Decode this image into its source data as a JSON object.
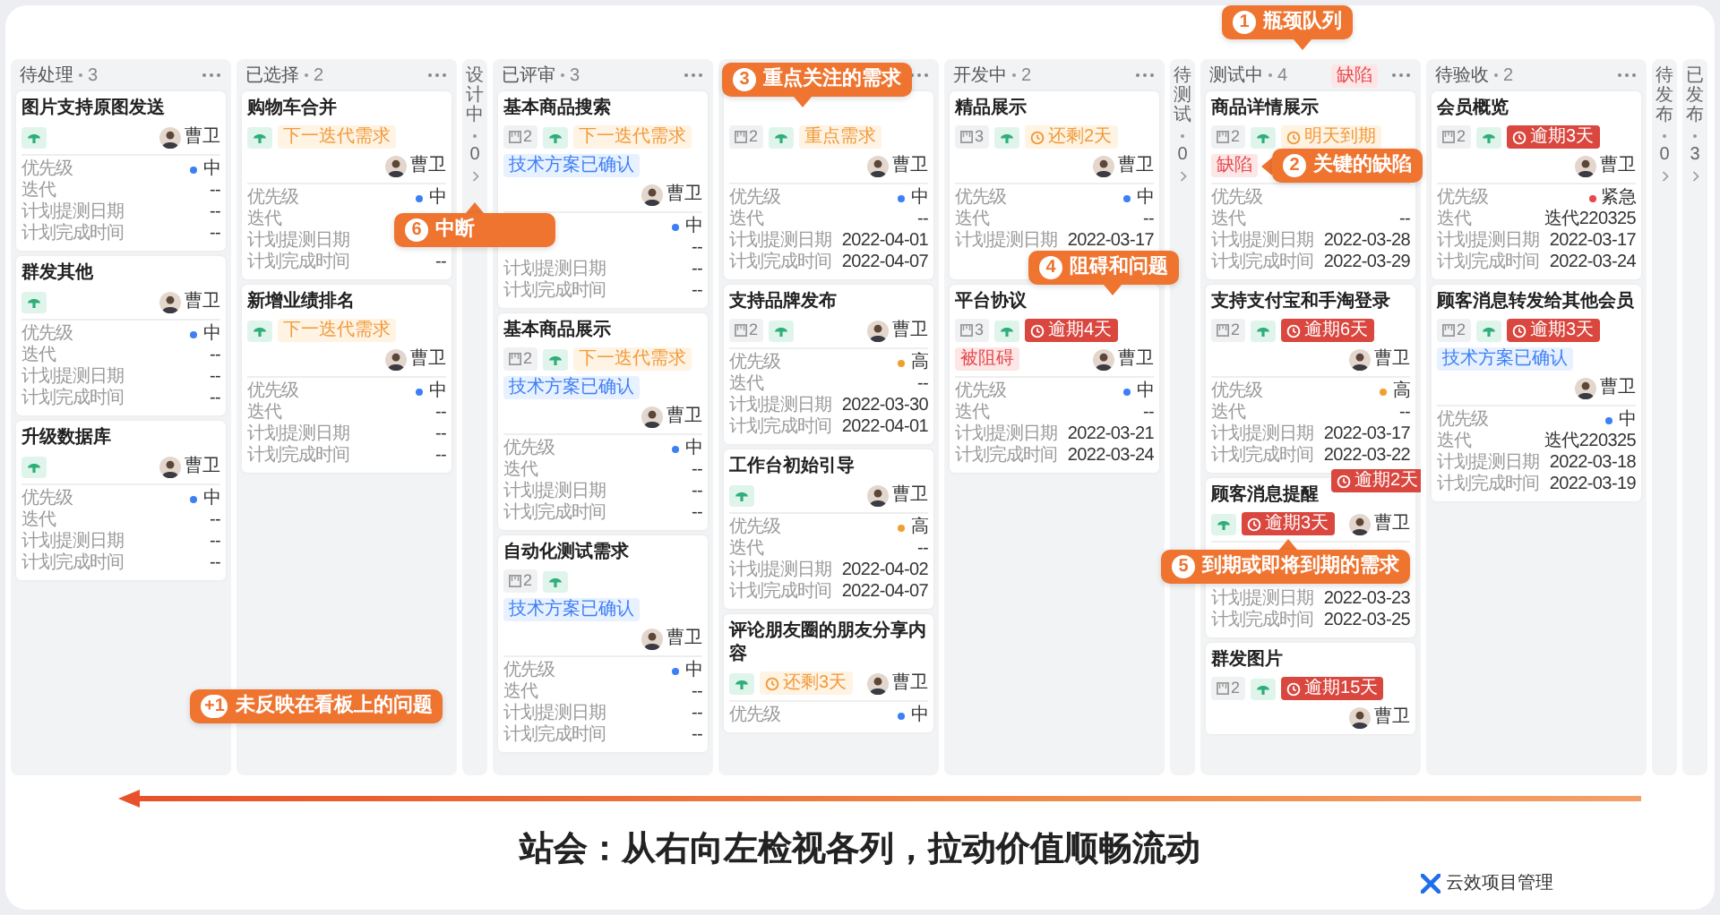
{
  "board": {
    "columns": [
      {
        "kind": "full",
        "title": "待处理",
        "count": "3",
        "cards": [
          {
            "title": "图片支持原图发送",
            "assignee": "曹卫",
            "fields": [
              {
                "label": "优先级",
                "value": "中",
                "color": "#3d7ff5"
              },
              {
                "label": "迭代",
                "value": "--"
              },
              {
                "label": "计划提测日期",
                "value": "--"
              },
              {
                "label": "计划完成时间",
                "value": "--"
              }
            ]
          },
          {
            "title": "群发其他",
            "assignee": "曹卫",
            "fields": [
              {
                "label": "优先级",
                "value": "中",
                "color": "#3d7ff5"
              },
              {
                "label": "迭代",
                "value": "--"
              },
              {
                "label": "计划提测日期",
                "value": "--"
              },
              {
                "label": "计划完成时间",
                "value": "--"
              }
            ]
          },
          {
            "title": "升级数据库",
            "assignee": "曹卫",
            "fields": [
              {
                "label": "优先级",
                "value": "中",
                "color": "#3d7ff5"
              },
              {
                "label": "迭代",
                "value": "--"
              },
              {
                "label": "计划提测日期",
                "value": "--"
              },
              {
                "label": "计划完成时间",
                "value": "--"
              }
            ]
          }
        ]
      },
      {
        "kind": "full",
        "title": "已选择",
        "count": "2",
        "cards": [
          {
            "title": "购物车合并",
            "tags": [
              {
                "kind": "note",
                "text": "下一迭代需求"
              }
            ],
            "assignee": "曹卫",
            "fields": [
              {
                "label": "优先级",
                "value": "中",
                "color": "#3d7ff5"
              },
              {
                "label": "迭代"
              },
              {
                "label": "计划提测日期"
              },
              {
                "label": "计划完成时间",
                "value": "--"
              }
            ]
          },
          {
            "title": "新增业绩排名",
            "tags": [
              {
                "kind": "note",
                "text": "下一迭代需求"
              }
            ],
            "assignee": "曹卫",
            "fields": [
              {
                "label": "优先级",
                "value": "中",
                "color": "#3d7ff5"
              },
              {
                "label": "迭代",
                "value": "--"
              },
              {
                "label": "计划提测日期",
                "value": "--"
              },
              {
                "label": "计划完成时间",
                "value": "--"
              }
            ]
          }
        ]
      },
      {
        "kind": "collapsed",
        "title": "设计中",
        "count": "0"
      },
      {
        "kind": "full",
        "title": "已评审",
        "count": "3",
        "cards": [
          {
            "title": "基本商品搜索",
            "points": "2",
            "tags": [
              {
                "kind": "note",
                "text": "下一迭代需求"
              },
              {
                "kind": "info",
                "text": "技术方案已确认"
              }
            ],
            "assignee": "曹卫",
            "fields": [
              {
                "value": "中",
                "color": "#3d7ff5"
              },
              {
                "value": "--"
              },
              {
                "label": "计划提测日期",
                "value": "--"
              },
              {
                "label": "计划完成时间",
                "value": "--"
              }
            ]
          },
          {
            "title": "基本商品展示",
            "points": "2",
            "tags": [
              {
                "kind": "note",
                "text": "下一迭代需求"
              },
              {
                "kind": "info",
                "text": "技术方案已确认"
              }
            ],
            "assignee": "曹卫",
            "fields": [
              {
                "label": "优先级",
                "value": "中",
                "color": "#3d7ff5"
              },
              {
                "label": "迭代",
                "value": "--"
              },
              {
                "label": "计划提测日期",
                "value": "--"
              },
              {
                "label": "计划完成时间",
                "value": "--"
              }
            ]
          },
          {
            "title": "自动化测试需求",
            "points": "2",
            "tags": [
              {
                "kind": "info",
                "text": "技术方案已确认"
              }
            ],
            "assignee": "曹卫",
            "fields": [
              {
                "label": "优先级",
                "value": "中",
                "color": "#3d7ff5"
              },
              {
                "label": "迭代",
                "value": "--"
              },
              {
                "label": "计划提测日期",
                "value": "--"
              },
              {
                "label": "计划完成时间",
                "value": "--"
              }
            ]
          }
        ]
      },
      {
        "kind": "full",
        "cards": [
          {
            "points": "2",
            "tags": [
              {
                "kind": "note",
                "text": "重点需求"
              }
            ],
            "assignee": "曹卫",
            "fields": [
              {
                "label": "优先级",
                "value": "中",
                "color": "#3d7ff5"
              },
              {
                "label": "迭代",
                "value": "--"
              },
              {
                "label": "计划提测日期",
                "value": "2022-04-01"
              },
              {
                "label": "计划完成时间",
                "value": "2022-04-07"
              }
            ]
          },
          {
            "title": "支持品牌发布",
            "points": "2",
            "assignee": "曹卫",
            "fields": [
              {
                "label": "优先级",
                "value": "高",
                "color": "#f0a030"
              },
              {
                "label": "迭代",
                "value": "--"
              },
              {
                "label": "计划提测日期",
                "value": "2022-03-30"
              },
              {
                "label": "计划完成时间",
                "value": "2022-04-01"
              }
            ]
          },
          {
            "title": "工作台初始引导",
            "assignee": "曹卫",
            "fields": [
              {
                "label": "优先级",
                "value": "高",
                "color": "#f0a030"
              },
              {
                "label": "迭代",
                "value": "--"
              },
              {
                "label": "计划提测日期",
                "value": "2022-04-02"
              },
              {
                "label": "计划完成时间",
                "value": "2022-04-07"
              }
            ]
          },
          {
            "title": "评论朋友圈的朋友分享内容",
            "tags": [
              {
                "kind": "deadline",
                "text": "还剩3天"
              }
            ],
            "assignee": "曹卫",
            "fields": [
              {
                "label": "优先级",
                "value": "中",
                "color": "#3d7ff5"
              }
            ]
          }
        ]
      },
      {
        "kind": "full",
        "title": "开发中",
        "count": "2",
        "cards": [
          {
            "title": "精品展示",
            "points": "3",
            "tags": [
              {
                "kind": "deadline",
                "text": "还剩2天"
              }
            ],
            "assignee": "曹卫",
            "fields": [
              {
                "label": "优先级",
                "value": "中",
                "color": "#3d7ff5"
              },
              {
                "label": "迭代",
                "value": "--"
              },
              {
                "label": "计划提测日期",
                "value": "2022-03-17"
              },
              {
                "covered": true
              }
            ]
          },
          {
            "title": "平台协议",
            "points": "3",
            "tags": [
              {
                "kind": "overdue",
                "text": "逾期4天"
              },
              {
                "kind": "alert",
                "text": "被阻碍"
              }
            ],
            "assignee": "曹卫",
            "fields": [
              {
                "label": "优先级",
                "value": "中",
                "color": "#3d7ff5"
              },
              {
                "label": "迭代",
                "value": "--"
              },
              {
                "label": "计划提测日期",
                "value": "2022-03-21"
              },
              {
                "label": "计划完成时间",
                "value": "2022-03-24"
              }
            ]
          }
        ]
      },
      {
        "kind": "collapsed",
        "title": "待测试",
        "count": "0"
      },
      {
        "kind": "full",
        "title": "测试中",
        "count": "4",
        "flag": "缺陷",
        "cards": [
          {
            "title": "商品详情展示",
            "points": "2",
            "tags": [
              {
                "kind": "deadline",
                "text": "明天到期"
              },
              {
                "kind": "alert",
                "text": "缺陷"
              }
            ],
            "fields": [
              {
                "label": "优先级"
              },
              {
                "label": "迭代",
                "value": "--"
              },
              {
                "label": "计划提测日期",
                "value": "2022-03-28"
              },
              {
                "label": "计划完成时间",
                "value": "2022-03-29"
              }
            ]
          },
          {
            "title": "支持支付宝和手淘登录",
            "points": "2",
            "tags": [
              {
                "kind": "overdue",
                "text": "逾期6天"
              }
            ],
            "assignee": "曹卫",
            "fields": [
              {
                "label": "优先级",
                "value": "高",
                "color": "#f0a030"
              },
              {
                "label": "迭代",
                "value": "--"
              },
              {
                "label": "计划提测日期",
                "value": "2022-03-17"
              },
              {
                "label": "计划完成时间",
                "value": "2022-03-22"
              }
            ]
          },
          {
            "badge": "逾期2天",
            "title": "顾客消息提醒",
            "tags": [
              {
                "kind": "overdue",
                "text": "逾期3天"
              }
            ],
            "assignee": "曹卫",
            "fields": [
              {
                "covered": true
              },
              {
                "covered": true
              },
              {
                "label": "计划提测日期",
                "value": "2022-03-23"
              },
              {
                "label": "计划完成时间",
                "value": "2022-03-25"
              }
            ]
          },
          {
            "title": "群发图片",
            "points": "2",
            "tags": [
              {
                "kind": "overdue",
                "text": "逾期15天"
              }
            ],
            "assignee": "曹卫"
          }
        ]
      },
      {
        "kind": "full",
        "title": "待验收",
        "count": "2",
        "cards": [
          {
            "title": "会员概览",
            "points": "2",
            "tags": [
              {
                "kind": "overdue",
                "text": "逾期3天"
              }
            ],
            "assignee": "曹卫",
            "fields": [
              {
                "label": "优先级",
                "value": "紧急",
                "color": "#e5484d"
              },
              {
                "label": "迭代",
                "value": "迭代220325"
              },
              {
                "label": "计划提测日期",
                "value": "2022-03-17"
              },
              {
                "label": "计划完成时间",
                "value": "2022-03-24"
              }
            ]
          },
          {
            "title": "顾客消息转发给其他会员",
            "points": "2",
            "tags": [
              {
                "kind": "overdue",
                "text": "逾期3天"
              },
              {
                "kind": "info",
                "text": "技术方案已确认"
              }
            ],
            "assignee": "曹卫",
            "fields": [
              {
                "label": "优先级",
                "value": "中",
                "color": "#3d7ff5"
              },
              {
                "label": "迭代",
                "value": "迭代220325"
              },
              {
                "label": "计划提测日期",
                "value": "2022-03-18"
              },
              {
                "label": "计划完成时间",
                "value": "2022-03-19"
              }
            ]
          }
        ]
      },
      {
        "kind": "collapsed",
        "title": "待发布",
        "count": "0"
      },
      {
        "kind": "collapsed",
        "title": "已发布",
        "count": "3"
      }
    ]
  },
  "callouts": [
    {
      "number": "1",
      "text": "瓶颈队列"
    },
    {
      "number": "2",
      "text": "关键的缺陷"
    },
    {
      "number": "3",
      "text": "重点关注的需求"
    },
    {
      "number": "4",
      "text": "阻碍和问题"
    },
    {
      "number": "5",
      "text": "到期或即将到期的需求"
    },
    {
      "number": "6",
      "text": "中断"
    },
    {
      "number": "+1",
      "text": "未反映在看板上的问题"
    }
  ],
  "caption": "站会：从右向左检视各列，拉动价值顺畅流动",
  "brand": {
    "name": "云效项目管理"
  }
}
